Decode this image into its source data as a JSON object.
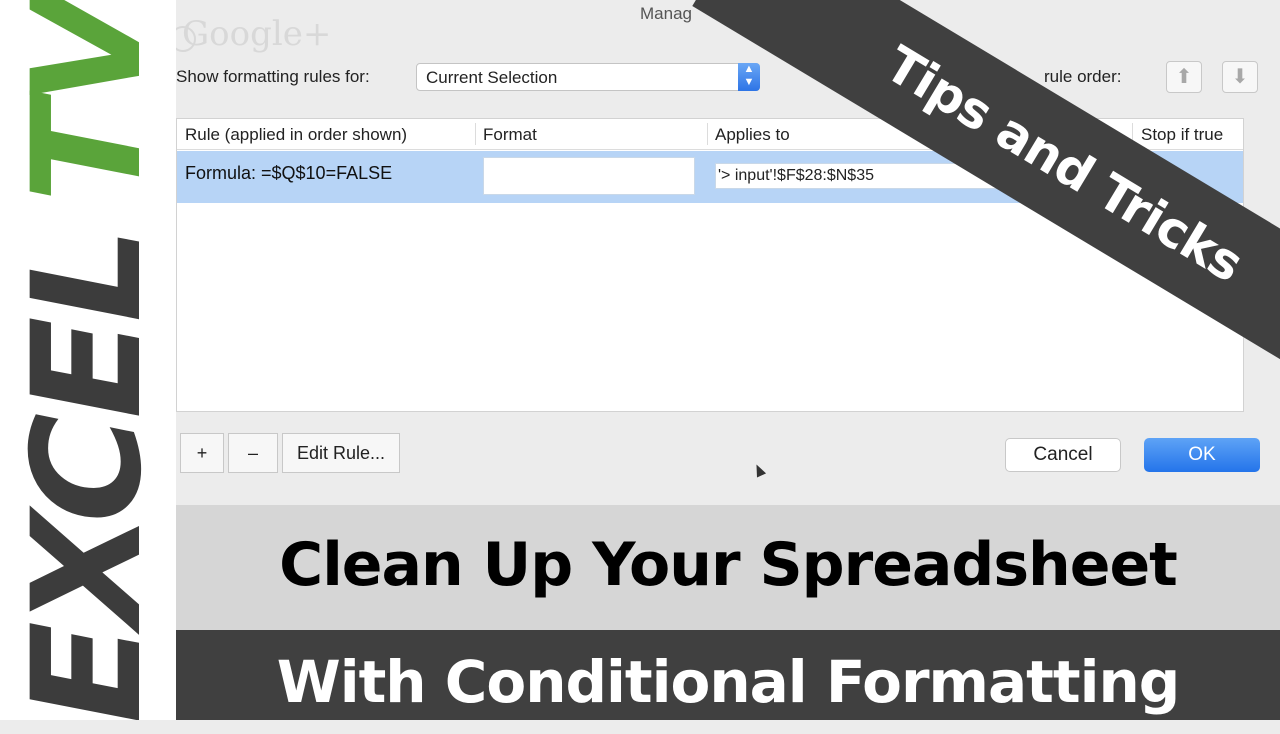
{
  "brand": {
    "excel": "EXCEL",
    "tv": "TV",
    "accent_color": "#5aa43a",
    "dark_color": "#3c3c3c"
  },
  "window": {
    "title": "Manag",
    "watermark": "Google+"
  },
  "filter": {
    "label": "Show formatting rules for:",
    "value": "Current Selection"
  },
  "order": {
    "label": "rule order:",
    "up_icon": "arrow-up-icon",
    "down_icon": "arrow-down-icon"
  },
  "table": {
    "headers": [
      "Rule (applied in order shown)",
      "Format",
      "Applies to",
      "Stop if true"
    ],
    "rows": [
      {
        "rule": "Formula: =$Q$10=FALSE",
        "format": "",
        "applies_to": "'> input'!$F$28:$N$35"
      }
    ]
  },
  "buttons": {
    "add": "+",
    "remove": "–",
    "edit": "Edit Rule...",
    "cancel": "Cancel",
    "ok": "OK"
  },
  "banner": {
    "text": "Tips and Tricks"
  },
  "title": {
    "line1": "Clean Up Your Spreadsheet",
    "line2": "With Conditional Formatting"
  }
}
